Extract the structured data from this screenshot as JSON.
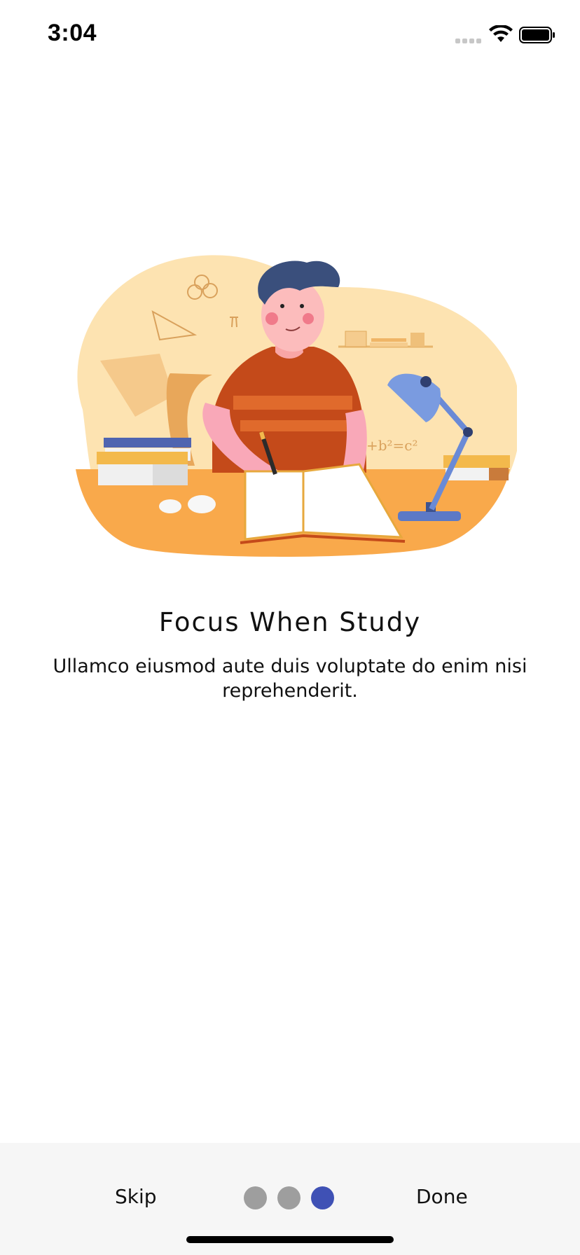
{
  "status_bar": {
    "time": "3:04"
  },
  "onboarding": {
    "title": "Focus When Study",
    "description": "Ullamco eiusmod aute duis voluptate do enim nisi reprehenderit."
  },
  "bottom_bar": {
    "skip_label": "Skip",
    "done_label": "Done",
    "page_count": 3,
    "active_page": 3
  },
  "colors": {
    "active_dot": "#3f51b5",
    "inactive_dot": "#9e9e9e",
    "bottom_bar_bg": "#f6f6f6"
  },
  "icons": {
    "signal": "cellular-signal-icon",
    "wifi": "wifi-icon",
    "battery": "battery-icon"
  }
}
